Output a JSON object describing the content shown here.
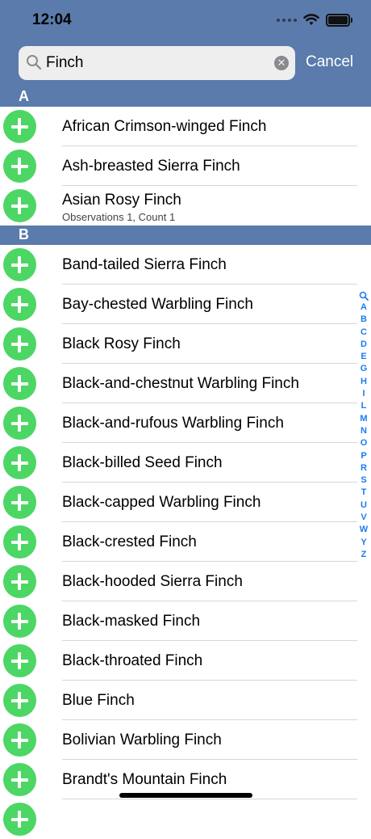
{
  "status": {
    "time": "12:04"
  },
  "search": {
    "value": "Finch",
    "cancel_label": "Cancel"
  },
  "sections": [
    {
      "letter": "A",
      "rows": [
        {
          "title": "African Crimson-winged Finch"
        },
        {
          "title": "Ash-breasted Sierra Finch"
        },
        {
          "title": "Asian Rosy Finch",
          "subtitle": "Observations 1, Count 1"
        }
      ]
    },
    {
      "letter": "B",
      "rows": [
        {
          "title": "Band-tailed Sierra Finch"
        },
        {
          "title": "Bay-chested Warbling Finch"
        },
        {
          "title": "Black Rosy Finch"
        },
        {
          "title": "Black-and-chestnut Warbling Finch"
        },
        {
          "title": "Black-and-rufous Warbling Finch"
        },
        {
          "title": "Black-billed Seed Finch"
        },
        {
          "title": "Black-capped Warbling Finch"
        },
        {
          "title": "Black-crested Finch"
        },
        {
          "title": "Black-hooded Sierra Finch"
        },
        {
          "title": "Black-masked Finch"
        },
        {
          "title": "Black-throated Finch"
        },
        {
          "title": "Blue Finch"
        },
        {
          "title": "Bolivian Warbling Finch"
        },
        {
          "title": "Brandt's Mountain Finch"
        }
      ]
    }
  ],
  "index_letters": [
    "A",
    "B",
    "C",
    "D",
    "E",
    "G",
    "H",
    "I",
    "L",
    "M",
    "N",
    "O",
    "P",
    "R",
    "S",
    "T",
    "U",
    "V",
    "W",
    "Y",
    "Z"
  ],
  "colors": {
    "header": "#5a7bab",
    "add_button": "#4cd664",
    "index": "#1a7cf0"
  }
}
